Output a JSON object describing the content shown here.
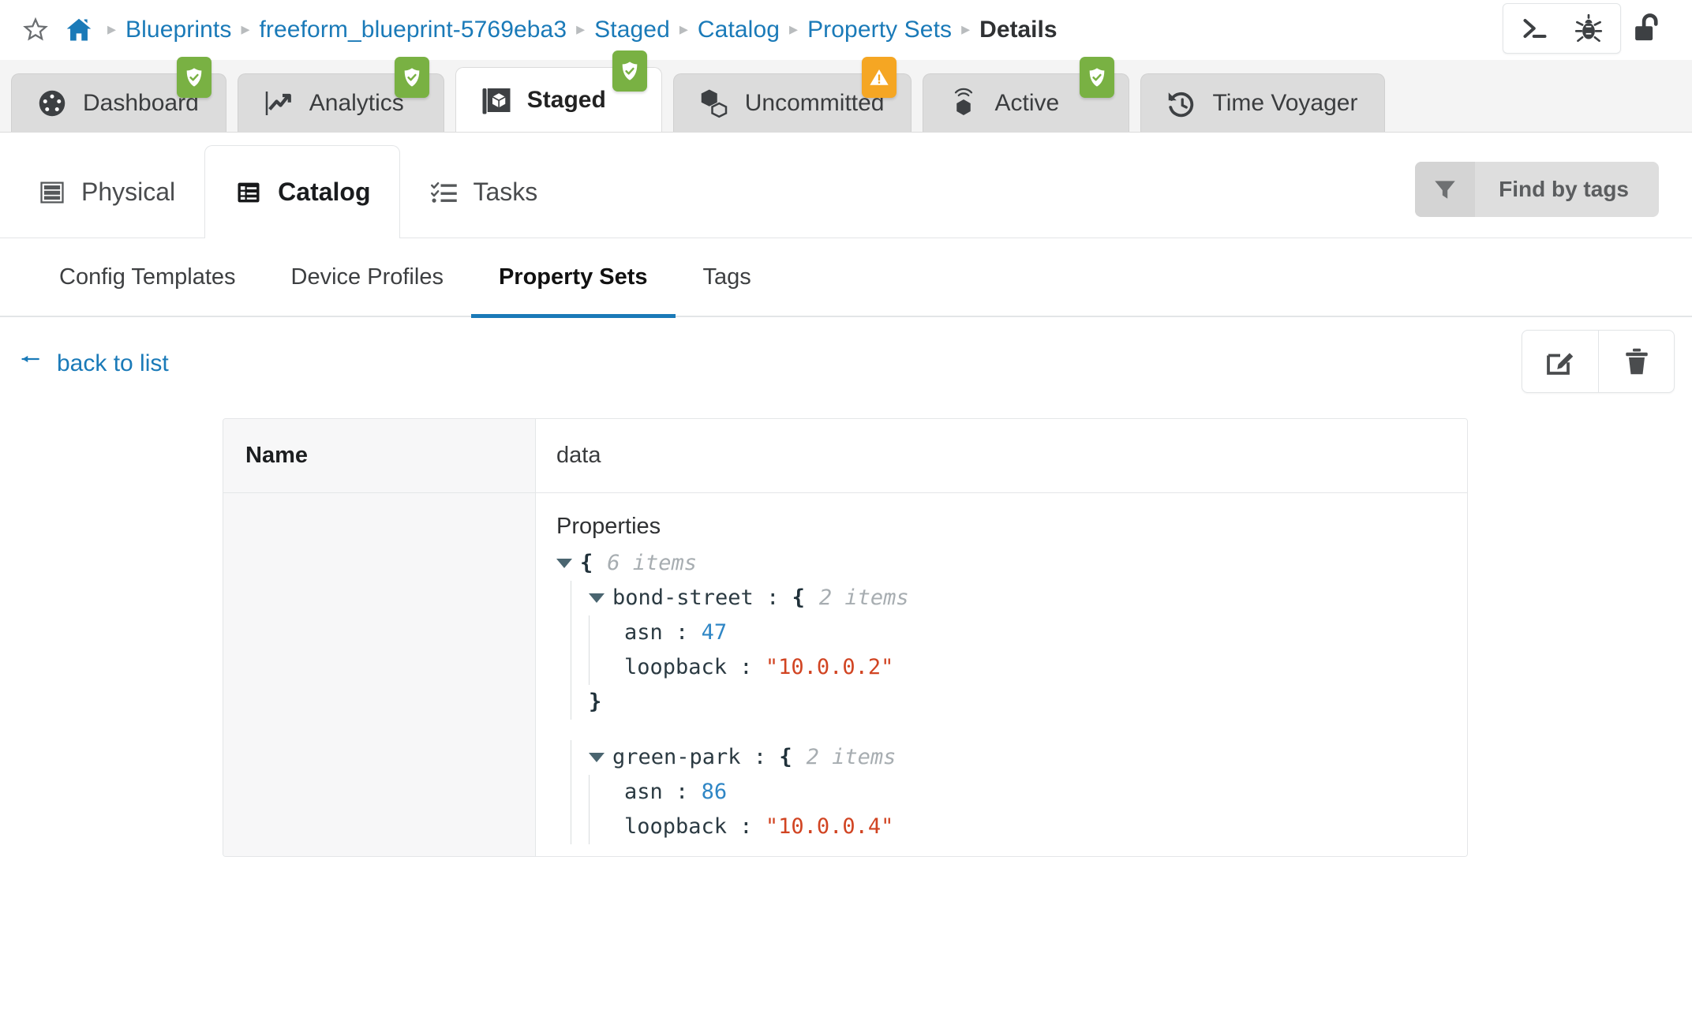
{
  "breadcrumb": {
    "star_icon": "star-icon",
    "home_icon": "home-icon",
    "separator": "▸",
    "items": [
      {
        "label": "Blueprints",
        "current": false
      },
      {
        "label": "freeform_blueprint-5769eba3",
        "current": false
      },
      {
        "label": "Staged",
        "current": false
      },
      {
        "label": "Catalog",
        "current": false
      },
      {
        "label": "Property Sets",
        "current": false
      },
      {
        "label": "Details",
        "current": true
      }
    ]
  },
  "toolbar": {
    "console_icon": "terminal-icon",
    "debug_icon": "bug-icon",
    "lock_icon": "unlocked-padlock-icon"
  },
  "primary_tabs": [
    {
      "label": "Dashboard",
      "icon": "gauge-icon",
      "badge": "ok",
      "active": false
    },
    {
      "label": "Analytics",
      "icon": "line-chart-icon",
      "badge": "ok",
      "active": false
    },
    {
      "label": "Staged",
      "icon": "staged-cube-icon",
      "badge": "ok",
      "active": true
    },
    {
      "label": "Uncommitted",
      "icon": "cubes-icon",
      "badge": "warn",
      "active": false
    },
    {
      "label": "Active",
      "icon": "live-cube-icon",
      "badge": "ok",
      "active": false
    },
    {
      "label": "Time Voyager",
      "icon": "history-icon",
      "badge": "none",
      "active": false
    }
  ],
  "secondary_tabs": [
    {
      "label": "Physical",
      "icon": "server-rack-icon",
      "active": false
    },
    {
      "label": "Catalog",
      "icon": "catalog-list-icon",
      "active": true
    },
    {
      "label": "Tasks",
      "icon": "checklist-icon",
      "active": false
    }
  ],
  "find_by_tags": {
    "label": "Find by tags",
    "icon": "filter-funnel-icon"
  },
  "tertiary_tabs": [
    {
      "label": "Config Templates",
      "active": false
    },
    {
      "label": "Device Profiles",
      "active": false
    },
    {
      "label": "Property Sets",
      "active": true
    },
    {
      "label": "Tags",
      "active": false
    }
  ],
  "back_link": {
    "label": "back to list",
    "icon": "arrow-left-icon"
  },
  "actions": [
    {
      "name": "edit",
      "icon": "edit-pencil-icon"
    },
    {
      "name": "delete",
      "icon": "trash-icon"
    }
  ],
  "detail": {
    "header_label": "Name",
    "header_value": "data",
    "properties_label": "Properties"
  },
  "json_tree": {
    "root_count": "6 items",
    "nodes": [
      {
        "key": "bond-street",
        "count": "2 items",
        "fields": [
          {
            "key": "asn",
            "value": "47",
            "type": "number"
          },
          {
            "key": "loopback",
            "value": "\"10.0.0.2\"",
            "type": "string"
          }
        ]
      },
      {
        "key": "green-park",
        "count": "2 items",
        "fields": [
          {
            "key": "asn",
            "value": "86",
            "type": "number"
          },
          {
            "key": "loopback",
            "value": "\"10.0.0.4\"",
            "type": "string"
          }
        ]
      }
    ]
  },
  "colors": {
    "link": "#1a7ab8",
    "badge_ok": "#79b143",
    "badge_warn": "#f5a623",
    "json_number": "#2f86c5",
    "json_string": "#d14422",
    "tab_underline": "#1a7ab8"
  }
}
